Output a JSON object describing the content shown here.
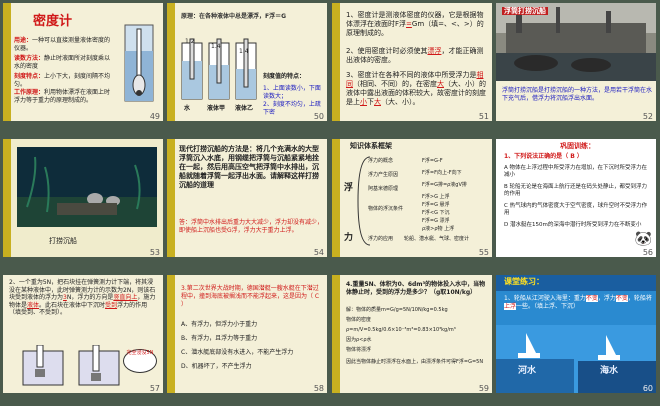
{
  "slides": [
    {
      "number": "49",
      "title": "密度计",
      "lines": [
        {
          "label": "用途：",
          "text": "一种可以直接测量液体密度的仪器。"
        },
        {
          "label": "读数方法：",
          "text": "静止时液面所对刻度乘以水的密度"
        },
        {
          "label": "刻度特点：",
          "text": "上小下大，刻度间隔不均匀。"
        },
        {
          "label": "工作原理：",
          "text": "利用物体漂浮在液面上时浮力等于重力的原理制成的。"
        }
      ]
    },
    {
      "number": "50",
      "principle": "原理：在各种液体中总是漂浮，F浮＝G",
      "tubes": [
        "1.2",
        "1.4",
        "1.4"
      ],
      "labels": [
        "水",
        "液体甲",
        "液体乙"
      ],
      "features_title": "刻度值的特点：",
      "features": [
        "1、上面读数小，下面读数大；",
        "2、刻度不均匀，上疏下密"
      ]
    },
    {
      "number": "51",
      "p1_a": "1、密度计是测液体密度的仪器，它是根据物体漂浮在液面时F浮",
      "p1_b": "Gm（填=、<、>）的原理制成的。",
      "p1_blank": "=",
      "p2_a": "2、使用密度计时必须使其",
      "p2_blank": "漂浮",
      "p2_b": "，才能正确测出液体的密度。",
      "p3_a": "3、密度计在各种不同的液体中所受浮力是",
      "p3_blank1": "相同",
      "p3_b": "（相同、不同）的，在密度",
      "p3_blank2": "大",
      "p3_c": "（大、小）的液体中露出液面的体积较大，故密度计的刻度是上",
      "p3_blank3": "小",
      "p3_d": "下",
      "p3_blank4": "大",
      "p3_e": "（大、小）。"
    },
    {
      "number": "52",
      "caption_title": "浮筒打捞沉船",
      "caption": "浮筒打捞沉船是打捞沉船的一种方法，是用若干浮筒在水下充气后，借浮力将沉船浮出水面。"
    },
    {
      "number": "53",
      "caption": "打捞沉船"
    },
    {
      "number": "54",
      "body": "现代打捞沉船的方法是：将几个充满水的大型浮筒沉入水底，用钢缆把浮筒与沉船紧紧地拴在一起，然后用高压空气把浮筒中水排出，沉船就随着浮筒一起浮出水面。请解释这样打捞沉船的道理",
      "note": "答：浮筒中水排出后重力大大减少，浮力却没有减少，即使船上沉船也受G浮，浮力大于重力上浮。"
    },
    {
      "number": "55",
      "title": "知识体系框架",
      "side": [
        "浮",
        "力"
      ],
      "branches": [
        "浮力的概念",
        "浮力产生原因",
        "阿基米德原理",
        "物体的浮沉条件",
        "浮力的应用"
      ],
      "leaves": [
        "F浮=G-F",
        "F浮=F向上-F向下",
        "F浮=G排=ρ液gV排",
        "F浮>G 上浮",
        "F浮=G 悬浮",
        "F浮<G 下沉",
        "F浮=G 漂浮",
        "ρ液>ρ物 上浮",
        "轮船、潜水艇、气球、密度计"
      ]
    },
    {
      "number": "56",
      "header": "巩固训练：",
      "q_title": "1、下列说法正确的是（  B  ）",
      "options": [
        "A 物体在上浮过程中所受浮力在增加，在下沉时所受浮力在减小",
        "B 轮船无论是在海面上航行还是在码头处静止，都受到浮力的作用",
        "C 热气球内的气体密度大于空气密度，球升空时不受浮力作用",
        "D 潜水艇在150m的深海中潜行时所受到浮力在不断变小"
      ]
    },
    {
      "number": "57",
      "text_a": "2、一个重为5N，把石块挂在弹簧测力计下端，将其浸没在某种液体中，此时弹簧测力计的示数为2N，则该石块受到液体的浮力为",
      "blank1": "3",
      "text_b": "N，浮力的方向是",
      "blank2": "竖直向上",
      "text_c": "，施力物体是",
      "blank3": "液体",
      "text_d": "。此石块在液体中下沉时",
      "blank4": "受到",
      "text_e": "浮力的作用（填受到、不受到）。",
      "bubble": "完全浸没5N"
    },
    {
      "number": "58",
      "question": "3.第二次世界大战时期，德国潜艇一艘水艇在下潜过程中，撞到海底被搁浅而不能浮起来，这是因为（  C  ）",
      "options": [
        "A、有浮力，但浮力小于重力",
        "B、有浮力，且浮力等于重力",
        "C、潜水艇底部没有水进入，不能产生浮力",
        "D、机器坏了，不产生浮力"
      ]
    },
    {
      "number": "59",
      "question": "4.重量5N、体积为0、6dm³的物体投入水中，当物体静止时，受到的浮力是多少？（g取10N/kg）",
      "solution": [
        "解：物体的质量m=G/g=5N/10N/kg=0.5kg",
        "物体的密度",
        "ρ=m/V=0.5kg/0.6×10⁻³m³=0.83×10³kg/m³",
        "因为ρ<ρ水",
        "物体将漂浮",
        "因此当物体静止时漂浮在水面上，由漂浮条件可得F浮=G=5N"
      ]
    },
    {
      "number": "60",
      "header": "课堂练习：",
      "q_a": "1、轮船从江河驶入海里：重力",
      "q_blank1": "不变",
      "q_b": "，浮力",
      "q_blank2": "不变",
      "q_c": "，轮船将",
      "q_blank3": "上浮",
      "q_d": "一些。（填上浮、下沉）",
      "water1": "河水",
      "water2": "海水"
    }
  ]
}
